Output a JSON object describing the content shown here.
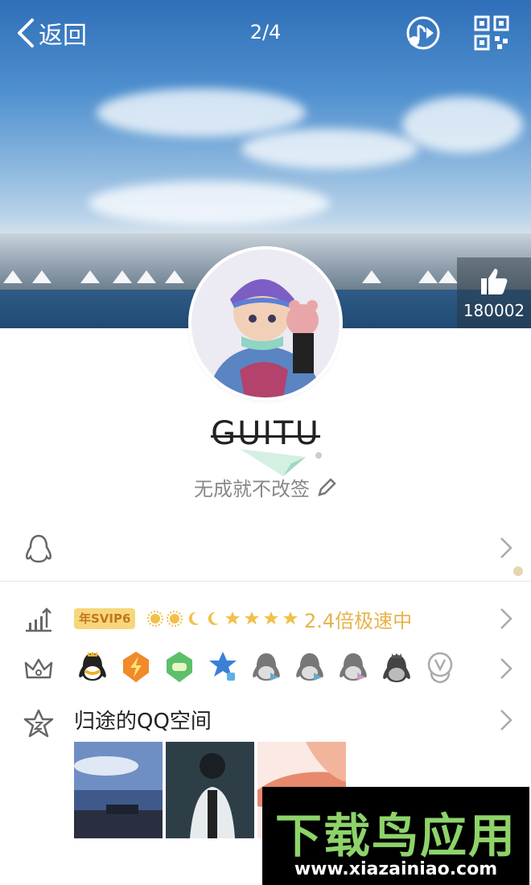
{
  "header": {
    "back_label": "返回",
    "page_counter": "2/4",
    "music_icon": "music-note-icon",
    "qr_icon": "qr-code-icon"
  },
  "cover": {
    "like_count": "180002",
    "like_icon": "thumbs-up-icon"
  },
  "profile": {
    "nickname": "GUITU",
    "signature": "无成就不改签",
    "edit_icon": "pencil-icon"
  },
  "rows": {
    "qq_icon": "qq-penguin-icon",
    "vip": {
      "icon": "level-chart-icon",
      "badge": "年SVIP6",
      "speed_text": "2.4倍极速中"
    },
    "services": {
      "icon": "crown-icon",
      "items": [
        "qq-vip-icon",
        "lightning-icon",
        "game-icon",
        "star-icon",
        "penguin-gray-icon",
        "penguin-gray-icon",
        "penguin-gray-icon",
        "penguin-dark-icon",
        "music-v-icon"
      ]
    },
    "qzone": {
      "icon": "star-zone-icon",
      "title": "归途的QQ空间"
    }
  },
  "watermark": {
    "title": "下载鸟应用",
    "url": "www.xiazainiao.com"
  },
  "colors": {
    "accent_gold": "#e8b34a",
    "badge_bg": "#f7d77a",
    "watermark_green": "#8dd36a"
  }
}
